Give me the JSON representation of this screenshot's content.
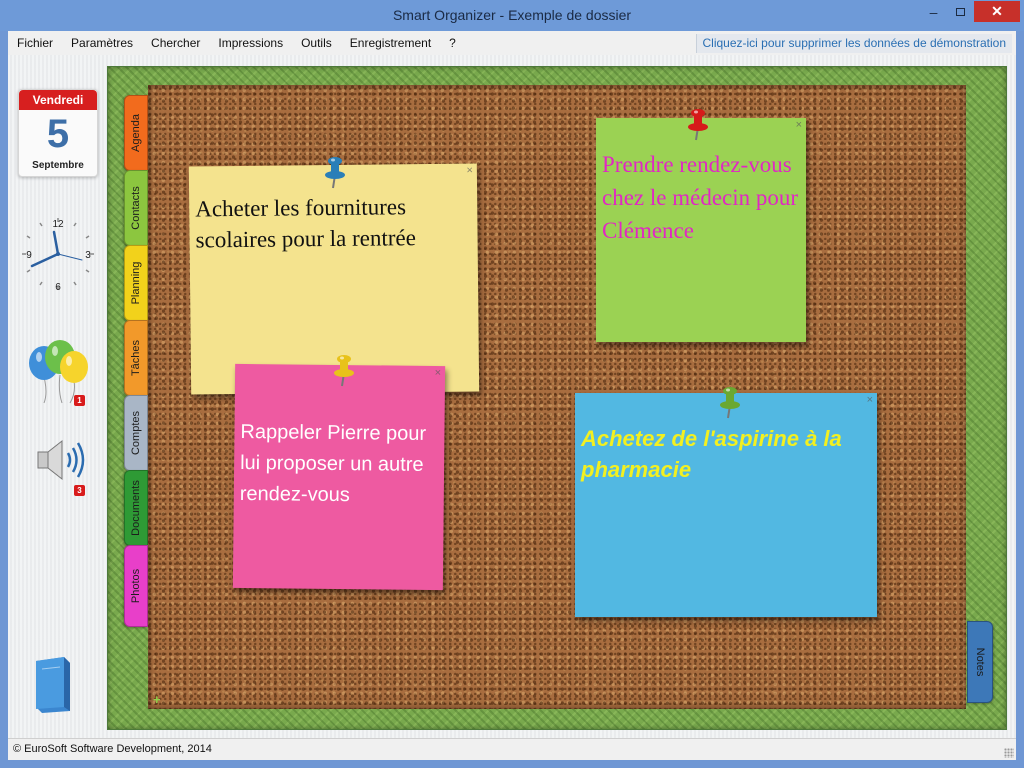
{
  "window": {
    "title": "Smart Organizer - Exemple de dossier",
    "min_glyph": "–",
    "close_glyph": "✕"
  },
  "menu": {
    "items": [
      "Fichier",
      "Paramètres",
      "Chercher",
      "Impressions",
      "Outils",
      "Enregistrement",
      "?"
    ],
    "demo_link": "Cliquez-ici pour supprimer les données de démonstration"
  },
  "calendar": {
    "day": "Vendredi",
    "date": "5",
    "month": "Septembre"
  },
  "clock": {
    "numerals": [
      "12",
      "3",
      "6",
      "9"
    ]
  },
  "badges": {
    "balloons": "1",
    "speaker": "3"
  },
  "tabs": {
    "agenda": "Agenda",
    "contacts": "Contacts",
    "planning": "Planning",
    "taches": "Tâches",
    "comptes": "Comptes",
    "documents": "Documents",
    "photos": "Photos",
    "notes": "Notes"
  },
  "notes": {
    "yellow": {
      "text": "Acheter les fournitures scolaires pour la rentrée",
      "color": "#f4e38e"
    },
    "green": {
      "text": "Prendre rendez-vous chez le médecin pour Clémence",
      "color": "#9bd253"
    },
    "pink": {
      "text": "Rappeler Pierre pour lui proposer un autre rendez-vous",
      "color": "#ee5aa1"
    },
    "blue": {
      "text": "Achetez de l'aspirine à la pharmacie",
      "color": "#52b8e2"
    },
    "close_glyph": "×",
    "add_glyph": "+"
  },
  "pins": {
    "yellow_note": "#2a7fb8",
    "green_note": "#d61a1a",
    "pink_note": "#e8c21a",
    "blue_note": "#6aa832"
  },
  "status": {
    "text": "© EuroSoft Software Development, 2014"
  }
}
